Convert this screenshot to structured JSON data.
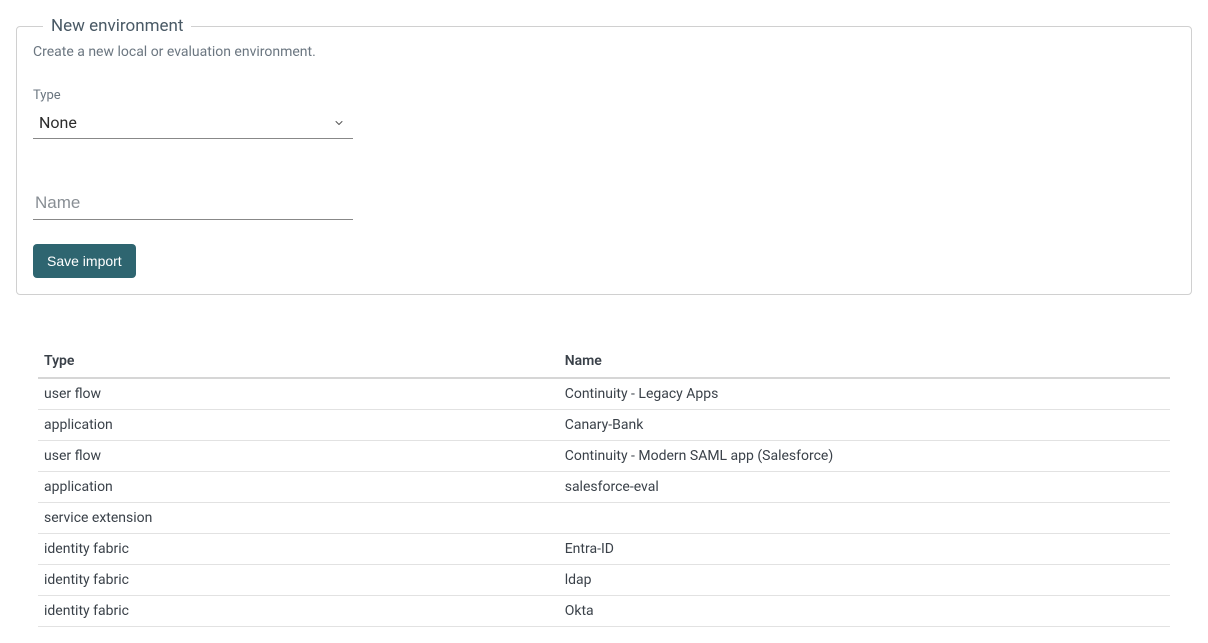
{
  "panel": {
    "legend": "New environment",
    "description": "Create a new local or evaluation environment.",
    "type_label": "Type",
    "type_value": "None",
    "name_placeholder": "Name",
    "name_value": "",
    "save_button": "Save import"
  },
  "table": {
    "headers": {
      "type": "Type",
      "name": "Name"
    },
    "rows": [
      {
        "type": "user flow",
        "name": "Continuity - Legacy Apps"
      },
      {
        "type": "application",
        "name": "Canary-Bank"
      },
      {
        "type": "user flow",
        "name": "Continuity - Modern SAML app (Salesforce)"
      },
      {
        "type": "application",
        "name": "salesforce-eval"
      },
      {
        "type": "service extension",
        "name": ""
      },
      {
        "type": "identity fabric",
        "name": "Entra-ID"
      },
      {
        "type": "identity fabric",
        "name": "ldap"
      },
      {
        "type": "identity fabric",
        "name": "Okta"
      }
    ]
  }
}
